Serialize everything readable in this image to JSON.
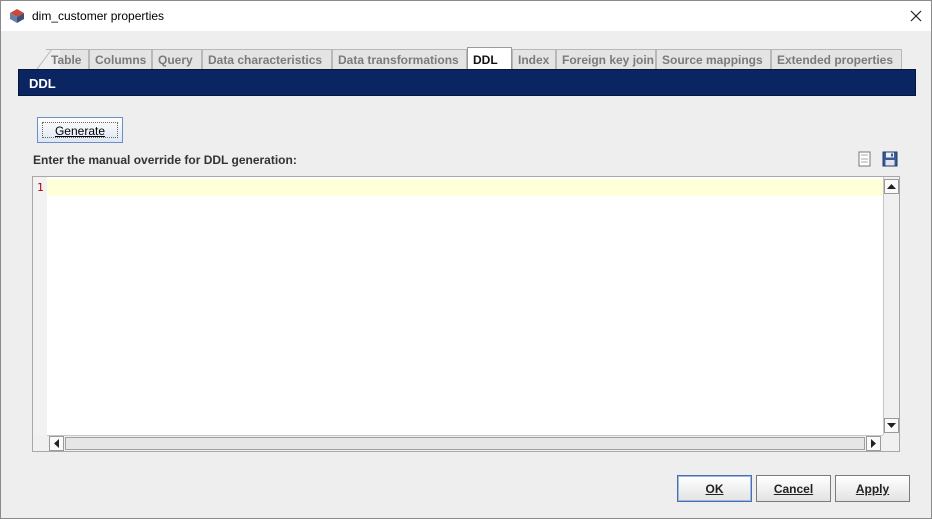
{
  "window": {
    "title": "dim_customer properties"
  },
  "tabs": [
    {
      "label": "Table",
      "active": false
    },
    {
      "label": "Columns",
      "active": false
    },
    {
      "label": "Query",
      "active": false
    },
    {
      "label": "Data characteristics",
      "active": false
    },
    {
      "label": "Data transformations",
      "active": false
    },
    {
      "label": "DDL",
      "active": true
    },
    {
      "label": "Index",
      "active": false
    },
    {
      "label": "Foreign key join",
      "active": false
    },
    {
      "label": "Source mappings",
      "active": false
    },
    {
      "label": "Extended properties",
      "active": false
    }
  ],
  "panel": {
    "header": "DDL",
    "generate_label": "Generate",
    "override_label": "Enter the manual override for DDL generation:",
    "icons": [
      "note-icon",
      "save-icon"
    ]
  },
  "editor": {
    "line_numbers": [
      "1"
    ],
    "content": ""
  },
  "buttons": {
    "ok": "OK",
    "cancel": "Cancel",
    "apply": "Apply"
  },
  "colors": {
    "header_bg": "#0b2563",
    "current_line": "#ffffd8",
    "line_number": "#b00000"
  }
}
